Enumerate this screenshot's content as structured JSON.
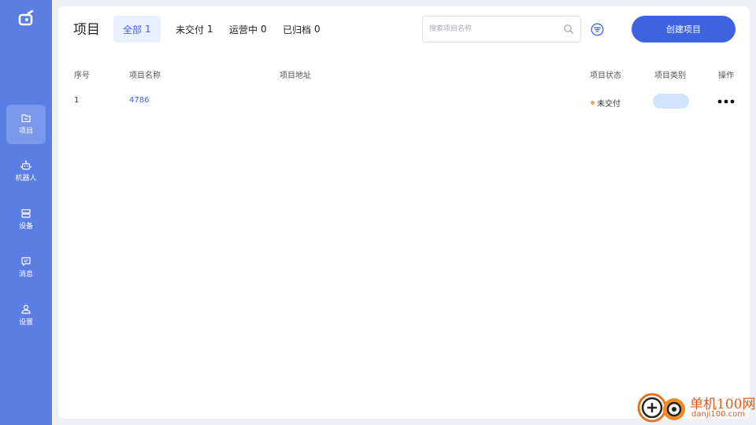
{
  "sidebar": {
    "logo_icon": "app-logo-icon",
    "items": [
      {
        "label": "项目",
        "icon": "project-folder-icon",
        "active": true
      },
      {
        "label": "机器人",
        "icon": "robot-icon",
        "active": false
      },
      {
        "label": "设备",
        "icon": "device-server-icon",
        "active": false
      },
      {
        "label": "消息",
        "icon": "message-icon",
        "active": false
      },
      {
        "label": "设置",
        "icon": "user-settings-icon",
        "active": false
      }
    ]
  },
  "header": {
    "title": "项目",
    "tabs": [
      {
        "label": "全部",
        "count": "1",
        "active": true
      },
      {
        "label": "未交付",
        "count": "1",
        "active": false
      },
      {
        "label": "运营中",
        "count": "0",
        "active": false
      },
      {
        "label": "已归档",
        "count": "0",
        "active": false
      }
    ],
    "search": {
      "placeholder": "搜索项目名称",
      "value": ""
    },
    "create_label": "创建项目"
  },
  "table": {
    "columns": [
      "序号",
      "项目名称",
      "项目地址",
      "项目状态",
      "项目类别",
      "操作"
    ],
    "rows": [
      {
        "index": "1",
        "name": "4786",
        "address": "",
        "status": "未交付",
        "category": ""
      }
    ]
  },
  "colors": {
    "sidebar": "#5b7ee5",
    "accent": "#3d63e0",
    "status_pending": "#f5a33c",
    "category_pill": "#d2e3fd"
  },
  "watermark": {
    "text": "单机100网",
    "url_text": "danji100.com"
  }
}
